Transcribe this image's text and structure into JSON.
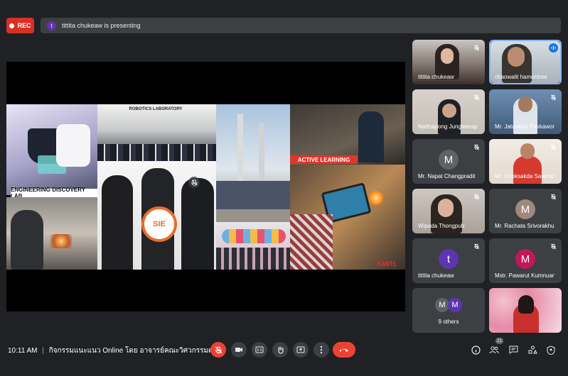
{
  "recording": {
    "label": "REC"
  },
  "presenter_bar": {
    "avatar_letter": "t",
    "text": "tittita chukeaw is presenting"
  },
  "slide": {
    "captions": {
      "engineering": "ENGINEERING DISCOVERY LAB",
      "active": "ACTIVE LEARNING",
      "robotics": "ROBOTICS LABORATORY",
      "kmitl": "KMITL",
      "sie_logo": "SIE"
    }
  },
  "participants": [
    {
      "name": "tittita chukeaw",
      "type": "video",
      "muted": true,
      "bg": "#8f8a86"
    },
    {
      "name": "chaowalit hamontree",
      "type": "video",
      "muted": false,
      "speaking": true,
      "bg": "#b7c0c8"
    },
    {
      "name": "Natthapong Jungteerapanich",
      "type": "video",
      "muted": true,
      "bg": "#cfcac4"
    },
    {
      "name": "Mr. Jaturapat Pakkawong",
      "type": "video",
      "muted": true,
      "bg": "#5d7fa3"
    },
    {
      "name": "Mr. Napat Changpradit",
      "type": "avatar",
      "muted": true,
      "letter": "M",
      "color": "#5f6368"
    },
    {
      "name": "Mr. Choksakda Sankram",
      "type": "video",
      "muted": true,
      "bg": "#e9e3dc"
    },
    {
      "name": "Wipada Thongpub",
      "type": "video",
      "muted": true,
      "bg": "#bdb4ae"
    },
    {
      "name": "Mr. Rachata Srivorakhun",
      "type": "avatar",
      "muted": true,
      "letter": "M",
      "color": "#a1887f"
    },
    {
      "name": "tittita chukeaw",
      "type": "avatar",
      "muted": true,
      "letter": "t",
      "color": "#5e35b1"
    },
    {
      "name": "Mstr. Pawarut Kumnuanrat",
      "type": "avatar",
      "muted": true,
      "letter": "M",
      "color": "#c2185b"
    }
  ],
  "others_tile": {
    "label": "9 others",
    "avatars": [
      "M",
      "M"
    ]
  },
  "bottom_bar": {
    "time": "10:11 AM",
    "meeting_title": "กิจกรรมแนะแนว Online โดย อาจารย์คณะวิศวกรรมศ...",
    "people_count": "21"
  },
  "colors": {
    "background": "#202124",
    "tile": "#3c4043",
    "danger": "#ea4335",
    "accent": "#8ab4f8"
  },
  "icons": [
    "mic-off-icon",
    "camera-icon",
    "captions-icon",
    "raise-hand-icon",
    "present-icon",
    "more-icon",
    "end-call-icon",
    "info-icon",
    "people-icon",
    "chat-icon",
    "activities-icon",
    "host-controls-icon"
  ]
}
